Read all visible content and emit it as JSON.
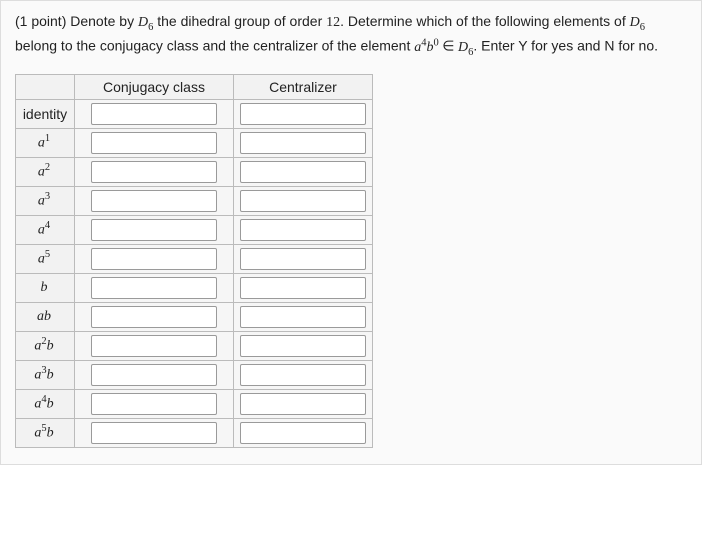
{
  "prompt": {
    "points_prefix": "(1 point) ",
    "text_a": "Denote by ",
    "D6_label": "D",
    "D6_sub": "6",
    "text_b": " the dihedral group of order ",
    "order": "12",
    "text_c": ". Determine which of the following elements of ",
    "text_d": " belong to the conjugacy class and the centralizer of the element ",
    "elem_a": "a",
    "elem_a_sup": "4",
    "elem_b": "b",
    "elem_b_sup": "0",
    "in_sym": " ∈ ",
    "text_e": ". Enter Y for yes and N for no."
  },
  "columns": {
    "conjugacy": "Conjugacy class",
    "centralizer": "Centralizer"
  },
  "rows": [
    {
      "label_plain": "identity",
      "a_exp": null,
      "has_b": false
    },
    {
      "a_exp": "1",
      "has_b": false
    },
    {
      "a_exp": "2",
      "has_b": false
    },
    {
      "a_exp": "3",
      "has_b": false
    },
    {
      "a_exp": "4",
      "has_b": false
    },
    {
      "a_exp": "5",
      "has_b": false
    },
    {
      "a_exp": null,
      "has_b": true
    },
    {
      "a_exp": "",
      "has_b": true
    },
    {
      "a_exp": "2",
      "has_b": true
    },
    {
      "a_exp": "3",
      "has_b": true
    },
    {
      "a_exp": "4",
      "has_b": true
    },
    {
      "a_exp": "5",
      "has_b": true
    }
  ]
}
